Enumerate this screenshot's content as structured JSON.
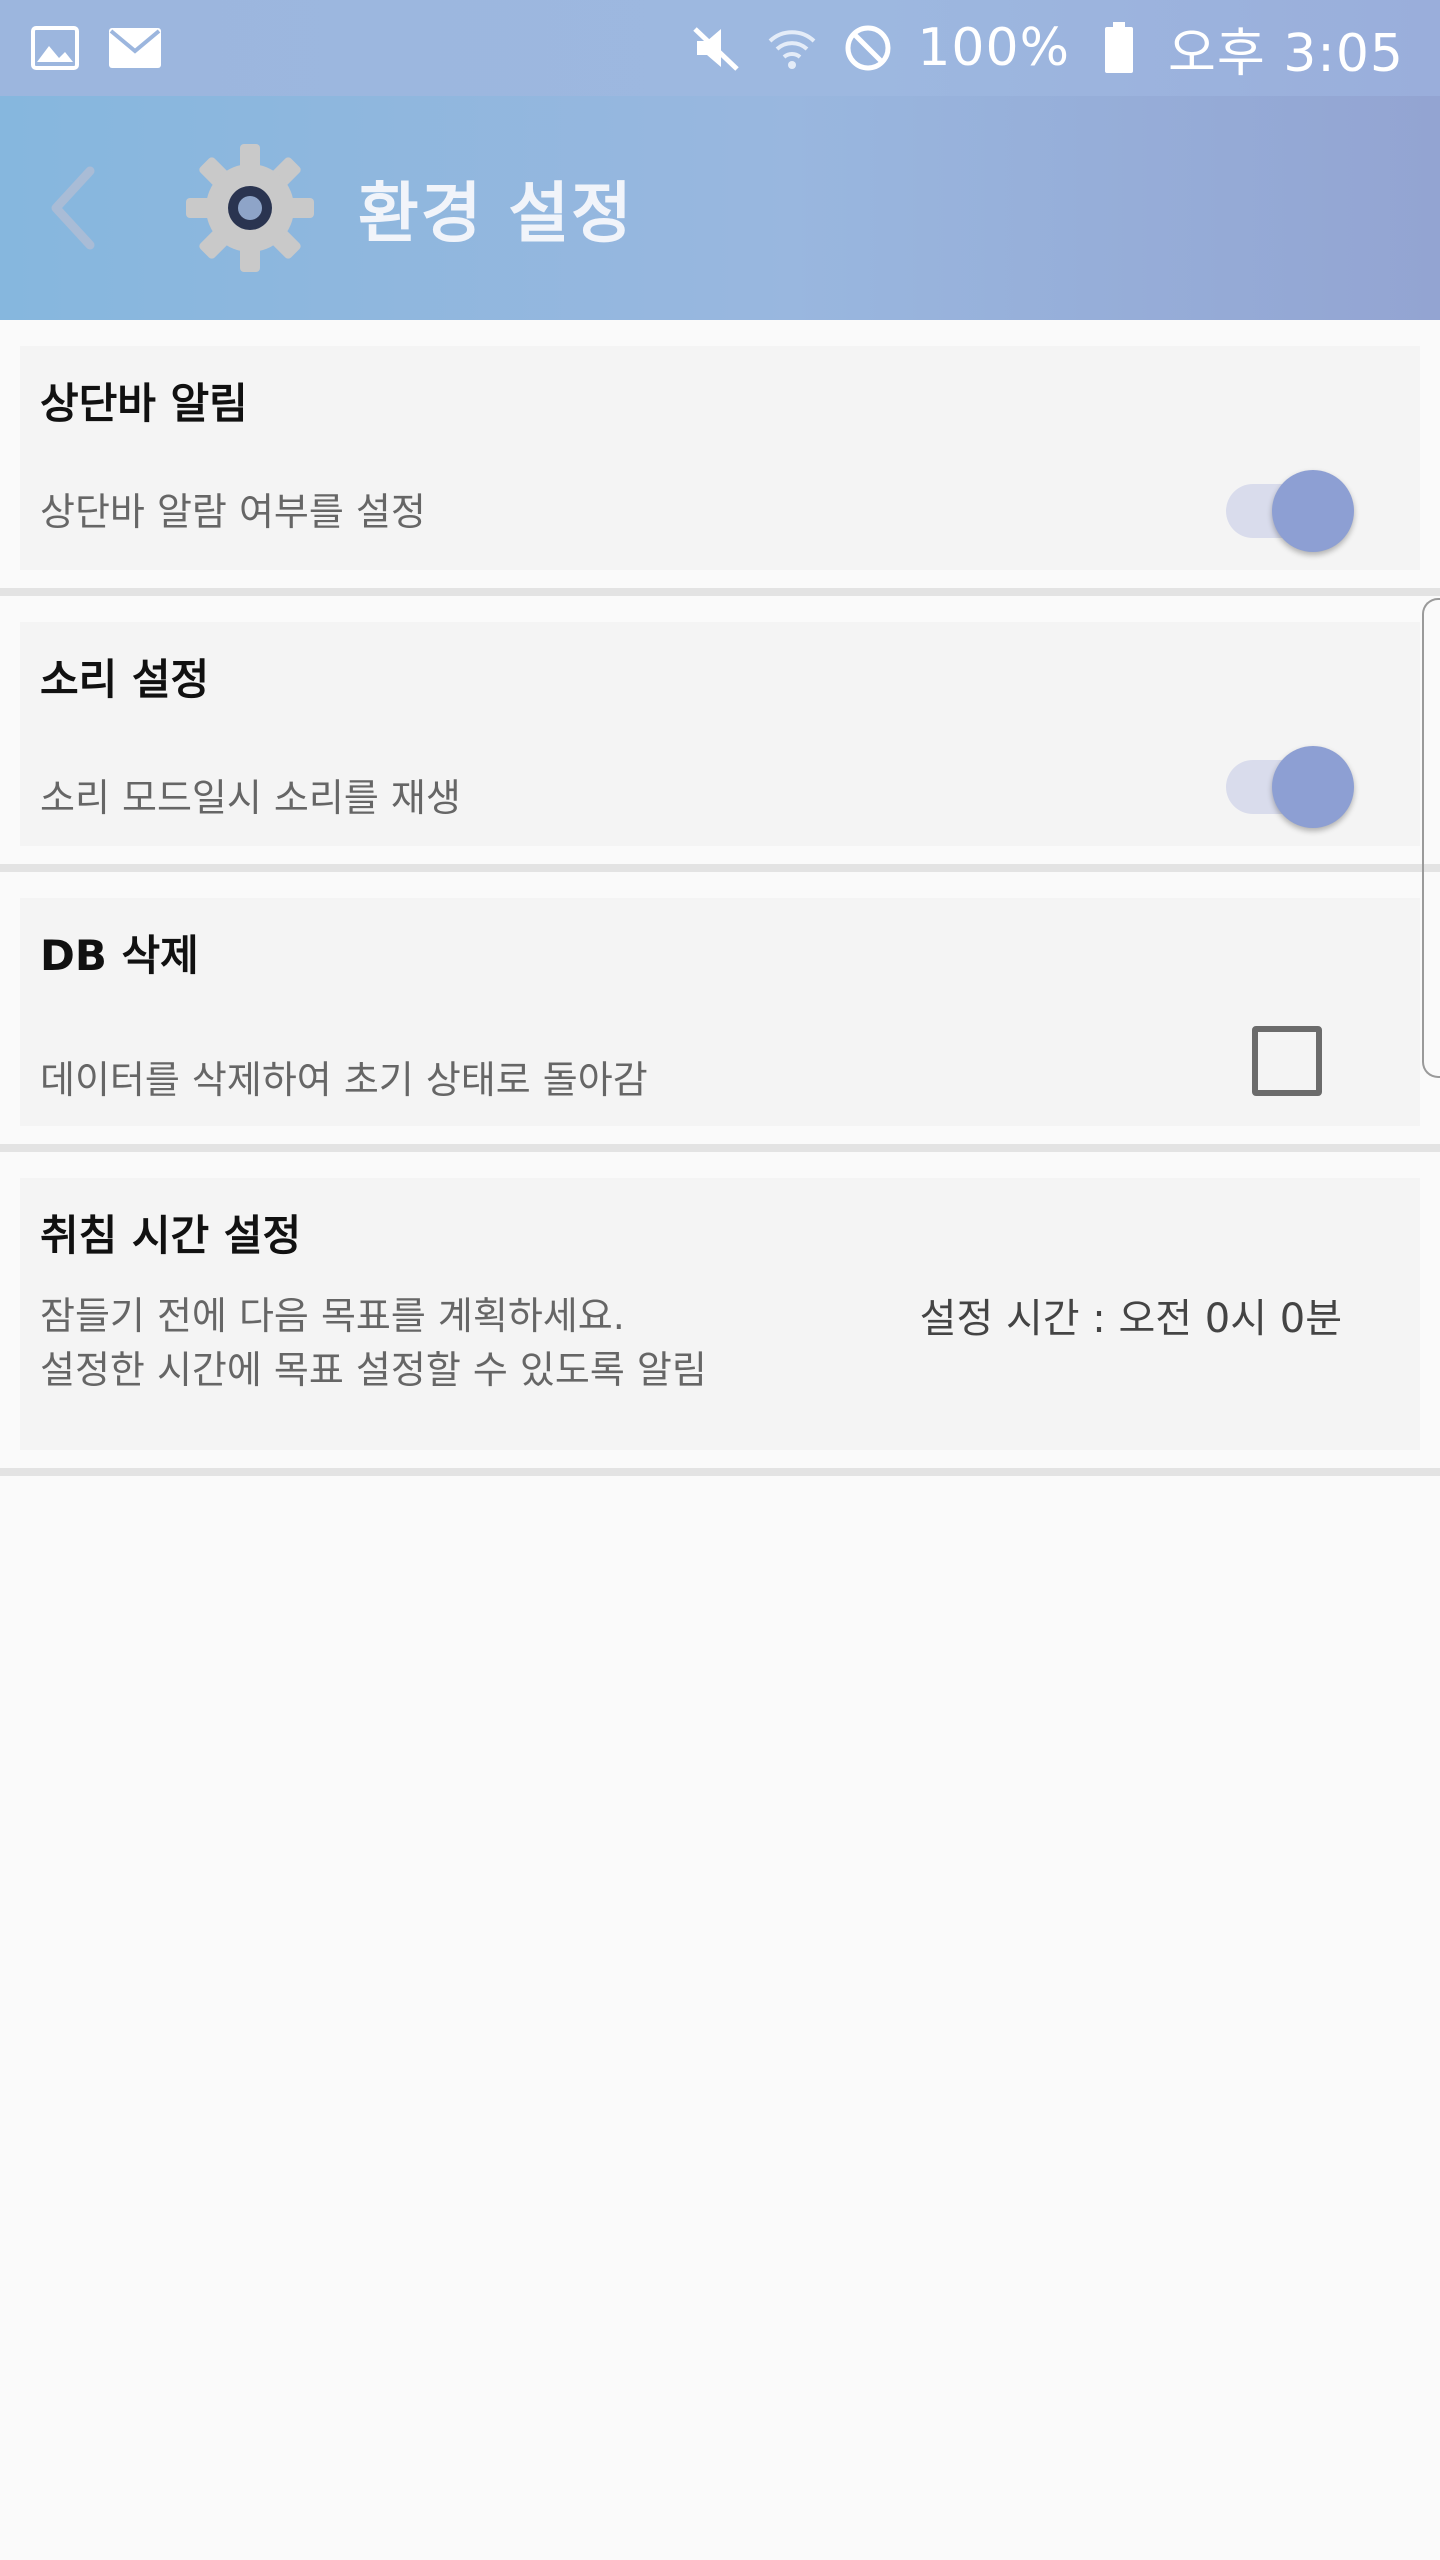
{
  "status_bar": {
    "icons_left": [
      "image-icon",
      "mail-icon"
    ],
    "icons_right": [
      "mute-icon",
      "wifi-icon",
      "blocked-icon",
      "battery-icon"
    ],
    "battery": "100%",
    "time": "오후 3:05"
  },
  "app_bar": {
    "title": "환경 설정"
  },
  "settings": [
    {
      "title": "상단바 알림",
      "description": "상단바 알람 여부를 설정",
      "control": "toggle",
      "on": true
    },
    {
      "title": "소리 설정",
      "description": "소리 모드일시 소리를 재생",
      "control": "toggle",
      "on": true
    },
    {
      "title": "DB 삭제",
      "description": "데이터를 삭제하여 초기 상태로 돌아감",
      "control": "checkbox",
      "checked": false
    },
    {
      "title": "취침 시간 설정",
      "description": "잠들기 전에 다음 목표를 계획하세요.\n설정한 시간에 목표 설정할 수 있도록 알림",
      "control": "time",
      "value": "설정 시간 : 오전 0시 0분"
    }
  ],
  "colors": {
    "accent": "#8d9fd3",
    "toggle_track": "#d9dcec",
    "app_bar": "#99b7df"
  }
}
